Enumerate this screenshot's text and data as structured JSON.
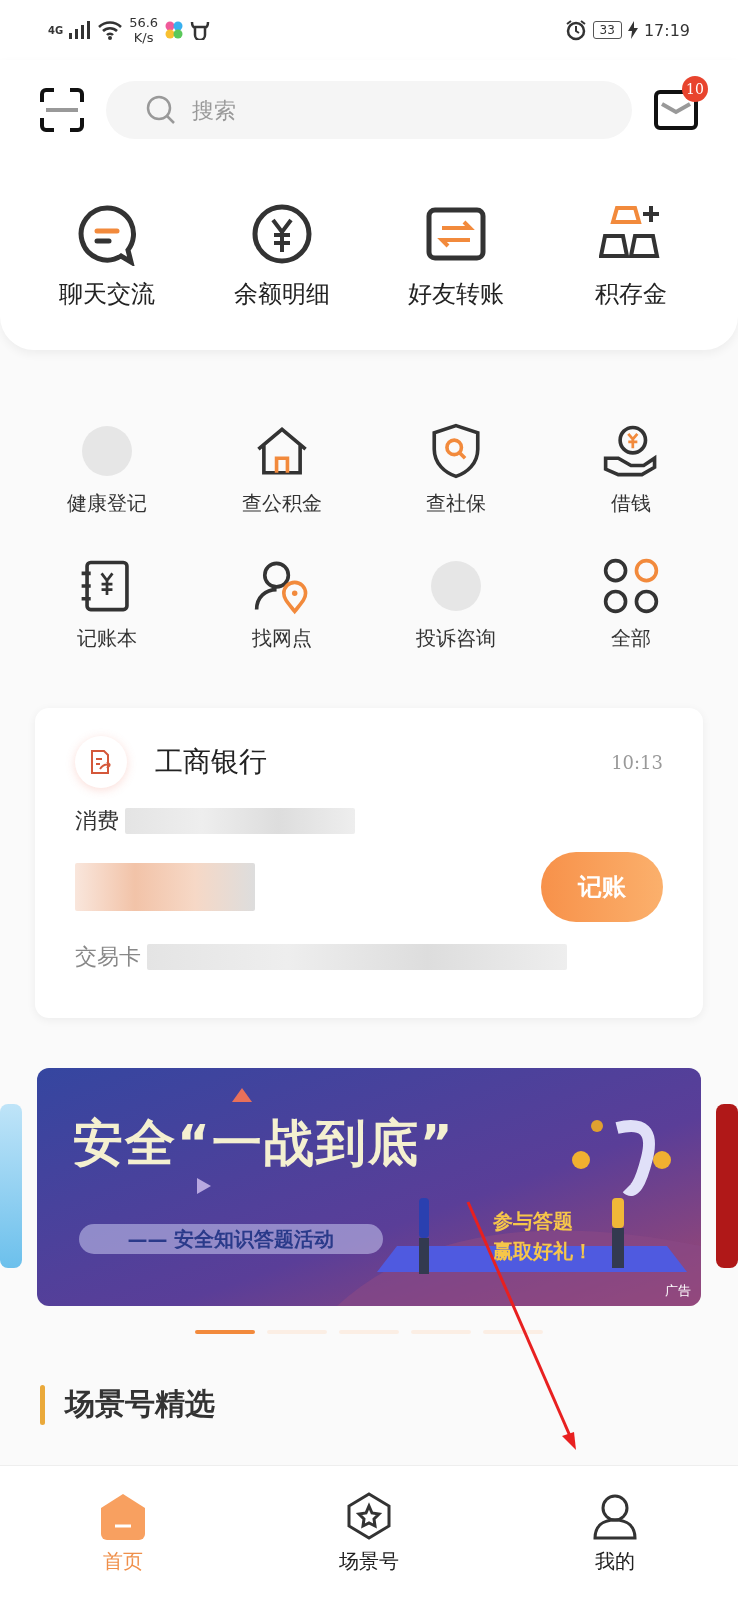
{
  "status_bar": {
    "network": "4G",
    "speed_value": "56.6",
    "speed_unit": "K/s",
    "battery": "33",
    "time": "17:19"
  },
  "search": {
    "placeholder": "搜索"
  },
  "mail_badge": "10",
  "quick_actions": [
    {
      "label": "聊天交流"
    },
    {
      "label": "余额明细"
    },
    {
      "label": "好友转账"
    },
    {
      "label": "积存金"
    }
  ],
  "services": [
    {
      "label": "健康登记"
    },
    {
      "label": "查公积金"
    },
    {
      "label": "查社保"
    },
    {
      "label": "借钱"
    },
    {
      "label": "记账本"
    },
    {
      "label": "找网点"
    },
    {
      "label": "投诉咨询"
    },
    {
      "label": "全部"
    }
  ],
  "message_card": {
    "title": "工商银行",
    "time": "10:13",
    "line_1": "消费",
    "line_3": "交易卡",
    "button": "记账"
  },
  "banner": {
    "title": "安全“一战到底”",
    "subtitle": "—— 安全知识答题活动",
    "slogan_1": "参与答题",
    "slogan_2": "赢取好礼！",
    "ad_label": "广告"
  },
  "pager": [
    {
      "selected": true
    },
    {
      "selected": false
    },
    {
      "selected": false
    },
    {
      "selected": false
    },
    {
      "selected": false
    }
  ],
  "section_title": "场景号精选",
  "nav": [
    {
      "label": "首页",
      "selected": true
    },
    {
      "label": "场景号",
      "selected": false
    },
    {
      "label": "我的",
      "selected": false
    }
  ]
}
